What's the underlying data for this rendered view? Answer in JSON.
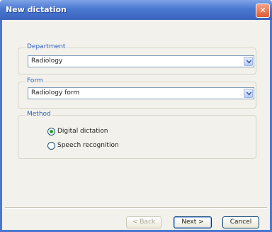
{
  "window": {
    "title": "New dictation",
    "close_glyph": "✕"
  },
  "department": {
    "label": "Department",
    "selected": "Radiology"
  },
  "form": {
    "label": "Form",
    "selected": "Radiology form"
  },
  "method": {
    "label": "Method",
    "options": [
      {
        "label": "Digital dictation",
        "selected": true
      },
      {
        "label": "Speech recognition",
        "selected": false
      }
    ]
  },
  "buttons": {
    "back": "< Back",
    "next": "Next >",
    "cancel": "Cancel"
  },
  "colors": {
    "titlebar": "#4a78d1",
    "group_label": "#2d5dc1",
    "radio_selected": "#21a121"
  }
}
